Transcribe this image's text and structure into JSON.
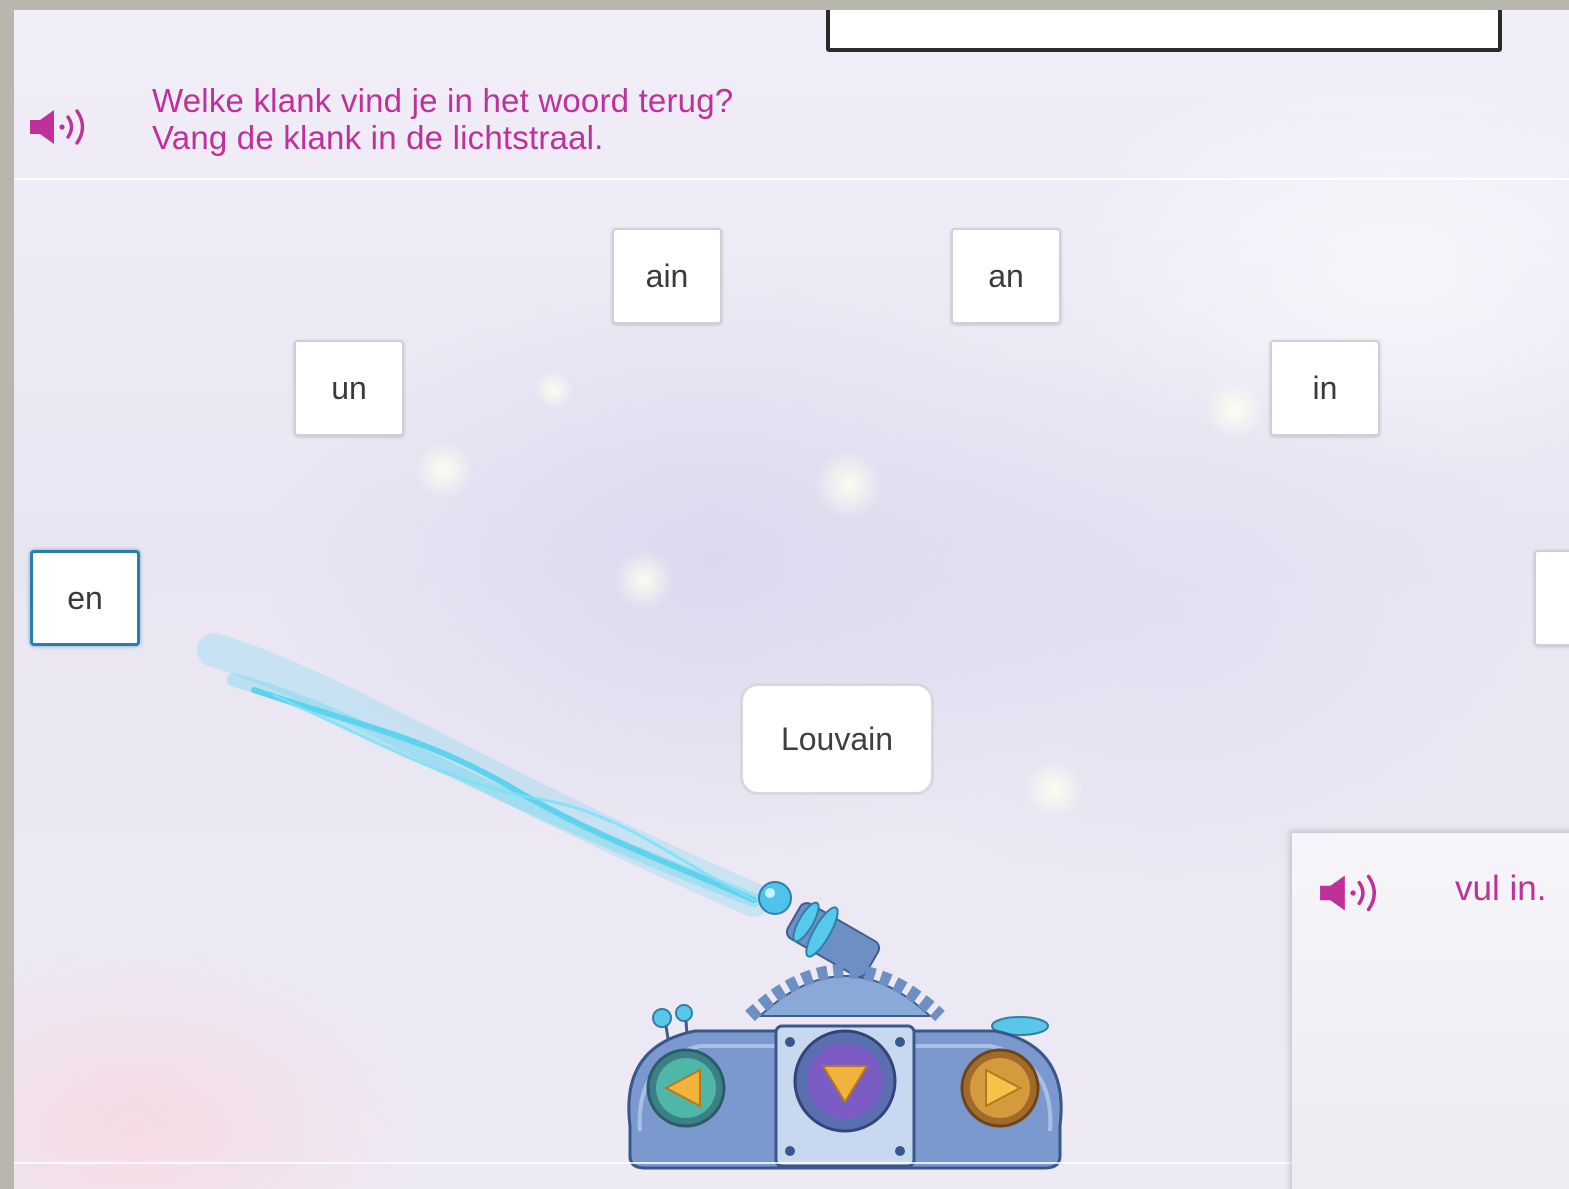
{
  "question": {
    "line1": "Welke klank vind je in het woord terug?",
    "line2": "Vang de klank in de lichtstraal."
  },
  "icons": {
    "question_audio": "speaker-icon",
    "panel_audio": "speaker-icon",
    "move_left": "arrow-left-icon",
    "shoot": "arrow-down-icon",
    "move_right": "arrow-right-icon"
  },
  "tiles": [
    "ain",
    "an",
    "un",
    "in",
    "en"
  ],
  "selected_tile": "en",
  "word": "Louvain",
  "panel": {
    "text": "vul in."
  },
  "colors": {
    "question_text": "#c0309a",
    "selected_border": "#2a7fa8",
    "beam": "#5fd3ee"
  }
}
